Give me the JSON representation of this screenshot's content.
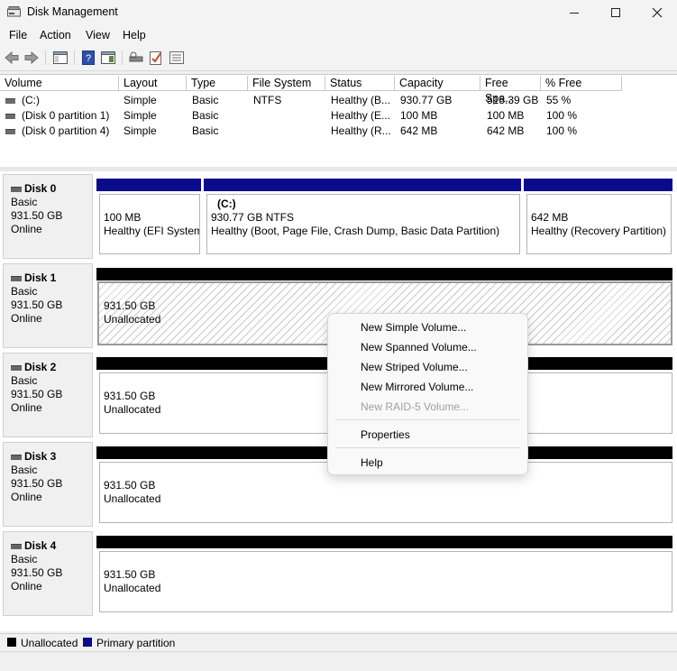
{
  "window": {
    "title": "Disk Management"
  },
  "menu": [
    "File",
    "Action",
    "View",
    "Help"
  ],
  "volume_list": {
    "columns": [
      "Volume",
      "Layout",
      "Type",
      "File System",
      "Status",
      "Capacity",
      "Free Spa...",
      "% Free"
    ],
    "rows": [
      [
        "(C:)",
        "Simple",
        "Basic",
        "NTFS",
        "Healthy (B...",
        "930.77 GB",
        "515.39 GB",
        "55 %"
      ],
      [
        "(Disk 0 partition 1)",
        "Simple",
        "Basic",
        "",
        "Healthy (E...",
        "100 MB",
        "100 MB",
        "100 %"
      ],
      [
        "(Disk 0 partition 4)",
        "Simple",
        "Basic",
        "",
        "Healthy (R...",
        "642 MB",
        "642 MB",
        "100 %"
      ]
    ]
  },
  "disks": [
    {
      "name": "Disk 0",
      "type": "Basic",
      "size": "931.50 GB",
      "status": "Online",
      "partitions": [
        {
          "label": "",
          "size": "100 MB",
          "status": "Healthy (EFI System"
        },
        {
          "label": "(C:)",
          "size": "930.77 GB NTFS",
          "status": "Healthy (Boot, Page File, Crash Dump, Basic Data Partition)"
        },
        {
          "label": "",
          "size": "642 MB",
          "status": "Healthy (Recovery Partition)"
        }
      ]
    },
    {
      "name": "Disk 1",
      "type": "Basic",
      "size": "931.50 GB",
      "status": "Online",
      "unalloc_size": "931.50 GB",
      "unalloc_label": "Unallocated"
    },
    {
      "name": "Disk 2",
      "type": "Basic",
      "size": "931.50 GB",
      "status": "Online",
      "unalloc_size": "931.50 GB",
      "unalloc_label": "Unallocated"
    },
    {
      "name": "Disk 3",
      "type": "Basic",
      "size": "931.50 GB",
      "status": "Online",
      "unalloc_size": "931.50 GB",
      "unalloc_label": "Unallocated"
    },
    {
      "name": "Disk 4",
      "type": "Basic",
      "size": "931.50 GB",
      "status": "Online",
      "unalloc_size": "931.50 GB",
      "unalloc_label": "Unallocated"
    }
  ],
  "legend": {
    "unallocated": "Unallocated",
    "primary": "Primary partition",
    "unallocated_color": "#000000",
    "primary_color": "#00008b"
  },
  "context_menu": {
    "new_simple": "New Simple Volume...",
    "new_spanned": "New Spanned Volume...",
    "new_striped": "New Striped Volume...",
    "new_mirrored": "New Mirrored Volume...",
    "new_raid5": "New RAID-5 Volume...",
    "properties": "Properties",
    "help": "Help"
  },
  "colors": {
    "primary_partition": "#0a0a8c",
    "unallocated": "#000000",
    "disabled_text": "#a0a0a0"
  }
}
